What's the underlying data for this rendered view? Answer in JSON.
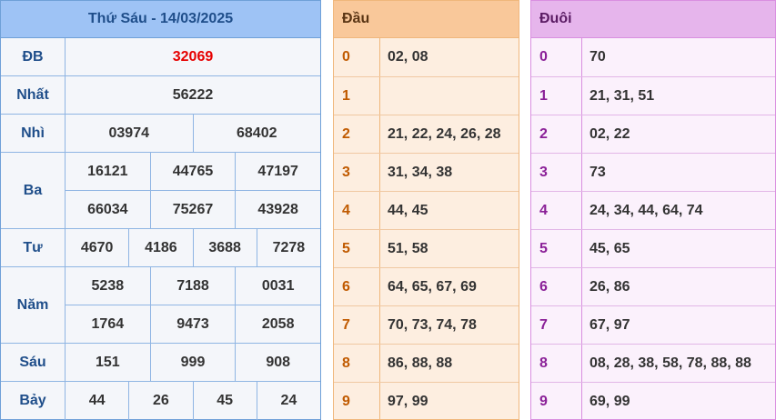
{
  "results": {
    "title": "Thứ Sáu - 14/03/2025",
    "prizes": [
      {
        "label": "ĐB",
        "lines": [
          [
            "32069"
          ]
        ],
        "special": true
      },
      {
        "label": "Nhất",
        "lines": [
          [
            "56222"
          ]
        ]
      },
      {
        "label": "Nhì",
        "lines": [
          [
            "03974",
            "68402"
          ]
        ]
      },
      {
        "label": "Ba",
        "lines": [
          [
            "16121",
            "44765",
            "47197"
          ],
          [
            "66034",
            "75267",
            "43928"
          ]
        ]
      },
      {
        "label": "Tư",
        "lines": [
          [
            "4670",
            "4186",
            "3688",
            "7278"
          ]
        ]
      },
      {
        "label": "Năm",
        "lines": [
          [
            "5238",
            "7188",
            "0031"
          ],
          [
            "1764",
            "9473",
            "2058"
          ]
        ]
      },
      {
        "label": "Sáu",
        "lines": [
          [
            "151",
            "999",
            "908"
          ]
        ]
      },
      {
        "label": "Bảy",
        "lines": [
          [
            "44",
            "26",
            "45",
            "24"
          ]
        ]
      }
    ]
  },
  "head_table": {
    "title": "Đầu",
    "rows": [
      {
        "key": "0",
        "value": "02, 08"
      },
      {
        "key": "1",
        "value": ""
      },
      {
        "key": "2",
        "value": "21, 22, 24, 26, 28"
      },
      {
        "key": "3",
        "value": "31, 34, 38"
      },
      {
        "key": "4",
        "value": "44, 45"
      },
      {
        "key": "5",
        "value": "51, 58"
      },
      {
        "key": "6",
        "value": "64, 65, 67, 69"
      },
      {
        "key": "7",
        "value": "70, 73, 74, 78"
      },
      {
        "key": "8",
        "value": "86, 88, 88"
      },
      {
        "key": "9",
        "value": "97, 99"
      }
    ]
  },
  "tail_table": {
    "title": "Đuôi",
    "rows": [
      {
        "key": "0",
        "value": "70"
      },
      {
        "key": "1",
        "value": "21, 31, 51"
      },
      {
        "key": "2",
        "value": "02, 22"
      },
      {
        "key": "3",
        "value": "73"
      },
      {
        "key": "4",
        "value": "24, 34, 44, 64, 74"
      },
      {
        "key": "5",
        "value": "45, 65"
      },
      {
        "key": "6",
        "value": "26, 86"
      },
      {
        "key": "7",
        "value": "67, 97"
      },
      {
        "key": "8",
        "value": "08, 28, 38, 58, 78, 88, 88"
      },
      {
        "key": "9",
        "value": "69, 99"
      }
    ]
  },
  "colors": {
    "special_prize": "#e60000",
    "results_header": "#9ec3f5",
    "head_header": "#f9c89a",
    "tail_header": "#e6b5ec"
  }
}
